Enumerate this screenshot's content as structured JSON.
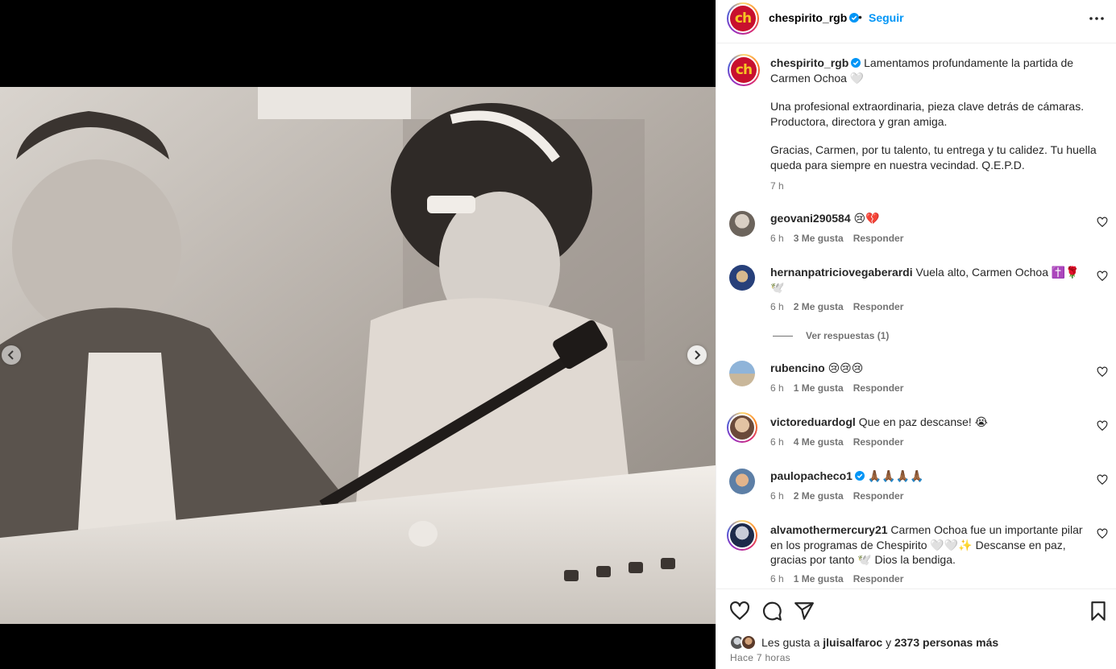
{
  "post": {
    "username": "chespirito_rgb",
    "follow_label": "Seguir",
    "separator": "•",
    "logo_text": "ch"
  },
  "caption": {
    "username": "chespirito_rgb",
    "line1": "Lamentamos profundamente la partida de Carmen Ochoa 🤍",
    "para2": "Una profesional extraordinaria, pieza clave detrás de cámaras. Productora, directora y gran amiga.",
    "para3": "Gracias, Carmen, por tu talento, tu entrega y tu calidez. Tu huella queda para siempre en nuestra vecindad. Q.E.P.D.",
    "time": "7 h"
  },
  "comments": [
    {
      "username": "geovani290584",
      "text": "😢💔",
      "time": "6 h",
      "likes": "3 Me gusta",
      "reply": "Responder"
    },
    {
      "username": "hernanpatriciovegaberardi",
      "text": "Vuela alto, Carmen Ochoa ✝️🌹🕊️",
      "time": "6 h",
      "likes": "2 Me gusta",
      "reply": "Responder",
      "view_replies": "Ver respuestas (1)"
    },
    {
      "username": "rubencino",
      "text": "😢😢😢",
      "time": "6 h",
      "likes": "1 Me gusta",
      "reply": "Responder"
    },
    {
      "username": "victoreduardogl",
      "text": "Que en paz descanse! 😭",
      "time": "6 h",
      "likes": "4 Me gusta",
      "reply": "Responder"
    },
    {
      "username": "paulopacheco1",
      "text": "🙏🏾🙏🏾🙏🏾🙏🏾",
      "time": "6 h",
      "likes": "2 Me gusta",
      "reply": "Responder"
    },
    {
      "username": "alvamothermercury21",
      "text": "Carmen Ochoa fue un importante pilar en los programas de Chespirito 🤍🤍✨ Descanse en paz, gracias por tanto 🕊️ Dios la bendiga.",
      "time": "6 h",
      "likes": "1 Me gusta",
      "reply": "Responder"
    }
  ],
  "likes_summary": {
    "prefix": "Les gusta a",
    "user": "jluisalfaroc",
    "connector": "y",
    "count_text": "2373 personas más"
  },
  "post_time": "Hace 7 horas",
  "colors": {
    "link_blue": "#0095f6",
    "verified_blue": "#0095f6",
    "muted": "#737373",
    "logo_red": "#c8102e",
    "logo_yellow": "#f6c624"
  },
  "icons": [
    "more-icon",
    "verified-icon",
    "heart-icon",
    "comment-icon",
    "share-icon",
    "bookmark-icon",
    "chevron-left-icon",
    "chevron-right-icon"
  ]
}
